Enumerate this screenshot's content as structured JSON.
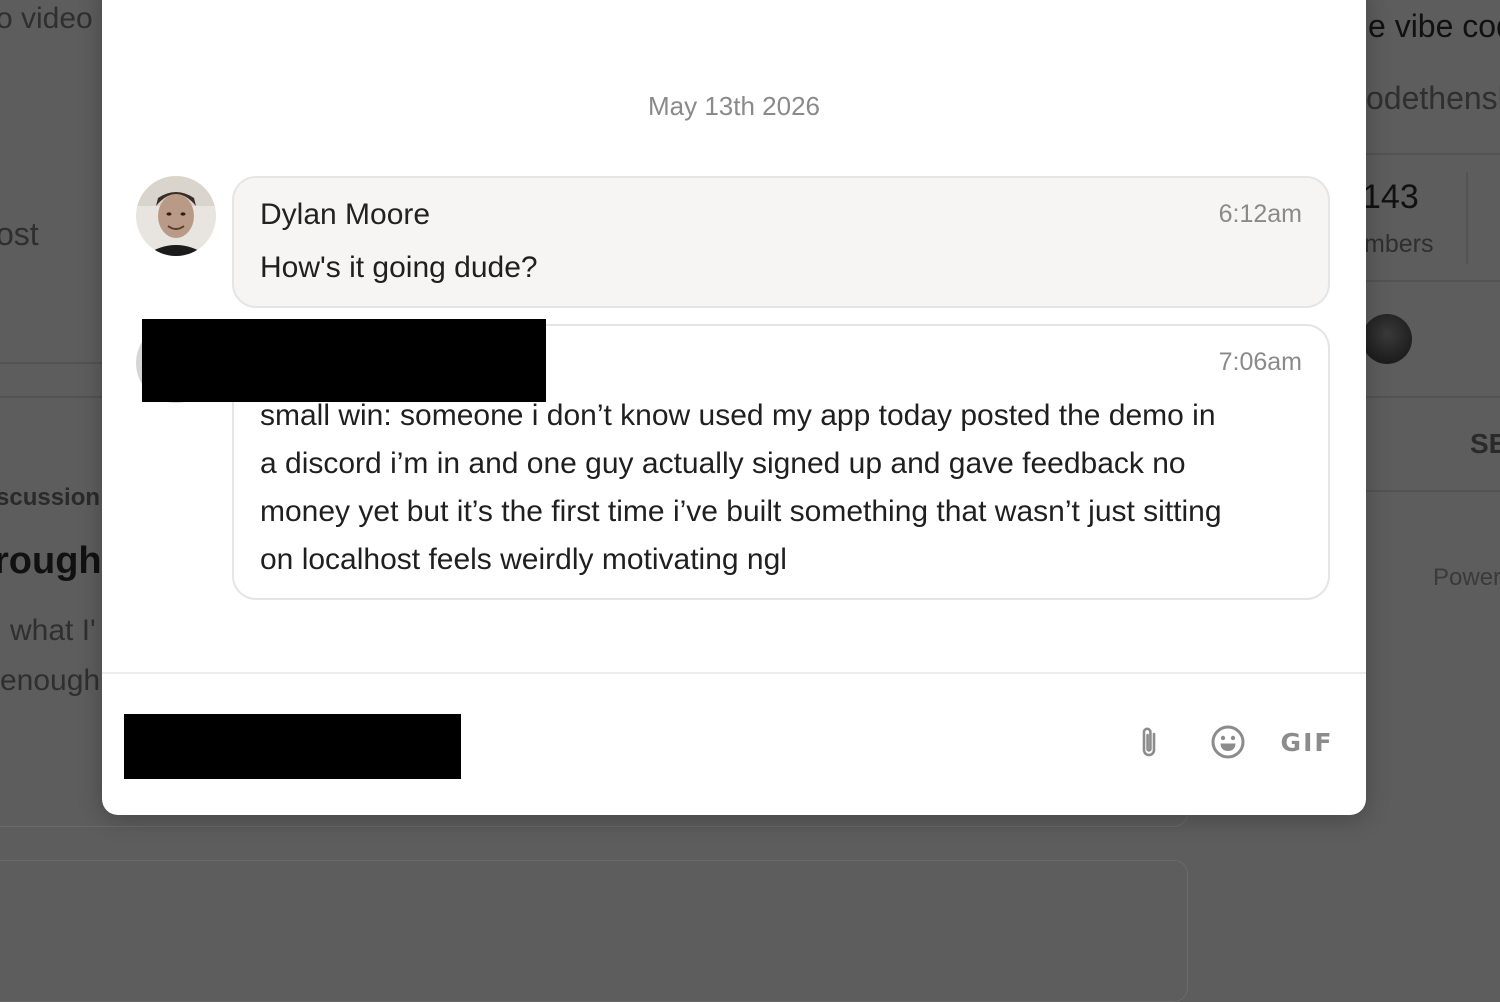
{
  "background": {
    "left_top": "o video",
    "left_post": "ost",
    "left_discussion": "scussion",
    "left_heading": "rough",
    "left_line1": "what I'",
    "left_line2": "enough",
    "right_title": "e vibe cod",
    "right_handle": "odethensh",
    "right_count": "143",
    "right_members": "mbers",
    "right_se": "SE",
    "right_power": "Power"
  },
  "chat": {
    "date": "May 13th 2026",
    "messages": [
      {
        "author": "Dylan Moore",
        "time": "6:12am",
        "text": "How's it going dude?"
      },
      {
        "author": "",
        "time": "7:06am",
        "lines": [
          "small win: someone i don’t know used my app today posted the demo in",
          "a discord i’m in and one guy actually signed up and gave feedback no",
          "money yet but it’s the first time i’ve built something that wasn’t just sitting",
          "on localhost feels weirdly motivating ngl"
        ]
      }
    ],
    "composer": {
      "gif_label": "GIF"
    }
  },
  "icons": {
    "attach": "paperclip-icon",
    "emoji": "emoji-icon"
  }
}
